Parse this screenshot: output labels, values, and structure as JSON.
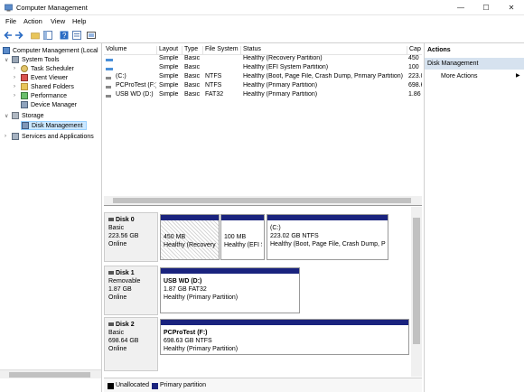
{
  "window": {
    "title": "Computer Management",
    "minimize_icon": "minimize-icon",
    "maximize_icon": "maximize-icon",
    "close_icon": "close-icon"
  },
  "menu": [
    "File",
    "Action",
    "View",
    "Help"
  ],
  "tree": {
    "root": "Computer Management (Local",
    "system_tools": "System Tools",
    "task_scheduler": "Task Scheduler",
    "event_viewer": "Event Viewer",
    "shared_folders": "Shared Folders",
    "performance": "Performance",
    "device_manager": "Device Manager",
    "storage": "Storage",
    "disk_management": "Disk Management",
    "services": "Services and Applications"
  },
  "volumes": {
    "headers": [
      "Volume",
      "Layout",
      "Type",
      "File System",
      "Status",
      "Cap"
    ],
    "rows": [
      {
        "volume": "",
        "layout": "Simple",
        "type": "Basic",
        "fs": "",
        "status": "Healthy (Recovery Partition)",
        "cap": "450"
      },
      {
        "volume": "",
        "layout": "Simple",
        "type": "Basic",
        "fs": "",
        "status": "Healthy (EFI System Partition)",
        "cap": "100"
      },
      {
        "volume": "(C:)",
        "layout": "Simple",
        "type": "Basic",
        "fs": "NTFS",
        "status": "Healthy (Boot, Page File, Crash Dump, Primary Partition)",
        "cap": "223.0"
      },
      {
        "volume": "PCProTest (F:)",
        "layout": "Simple",
        "type": "Basic",
        "fs": "NTFS",
        "status": "Healthy (Primary Partition)",
        "cap": "698.6"
      },
      {
        "volume": "USB WD (D:)",
        "layout": "Simple",
        "type": "Basic",
        "fs": "FAT32",
        "status": "Healthy (Primary Partition)",
        "cap": "1.86"
      }
    ]
  },
  "disks": [
    {
      "name": "Disk 0",
      "type": "Basic",
      "size": "223.56 GB",
      "state": "Online"
    },
    {
      "name": "Disk 1",
      "type": "Removable",
      "size": "1.87 GB",
      "state": "Online"
    },
    {
      "name": "Disk 2",
      "type": "Basic",
      "size": "698.64 GB",
      "state": "Online"
    }
  ],
  "partitions": {
    "d0_recovery": {
      "size": "450 MB",
      "status": "Healthy (Recovery"
    },
    "d0_efi": {
      "size": "100 MB",
      "status": "Healthy (EFI S"
    },
    "d0_c": {
      "label": "(C:)",
      "size": "223.02 GB NTFS",
      "status": "Healthy (Boot, Page File, Crash Dump, Pr"
    },
    "d1_usb": {
      "label": "USB WD  (D:)",
      "size": "1.87 GB FAT32",
      "status": "Healthy (Primary Partition)"
    },
    "d2_pcpro": {
      "label": "PCProTest  (F:)",
      "size": "698.63 GB NTFS",
      "status": "Healthy (Primary Partition)"
    }
  },
  "legend": {
    "unallocated": "Unallocated",
    "primary": "Primary partition",
    "unallocated_color": "#000000",
    "primary_color": "#1a237e"
  },
  "actions": {
    "title": "Actions",
    "section": "Disk Management",
    "more": "More Actions"
  }
}
